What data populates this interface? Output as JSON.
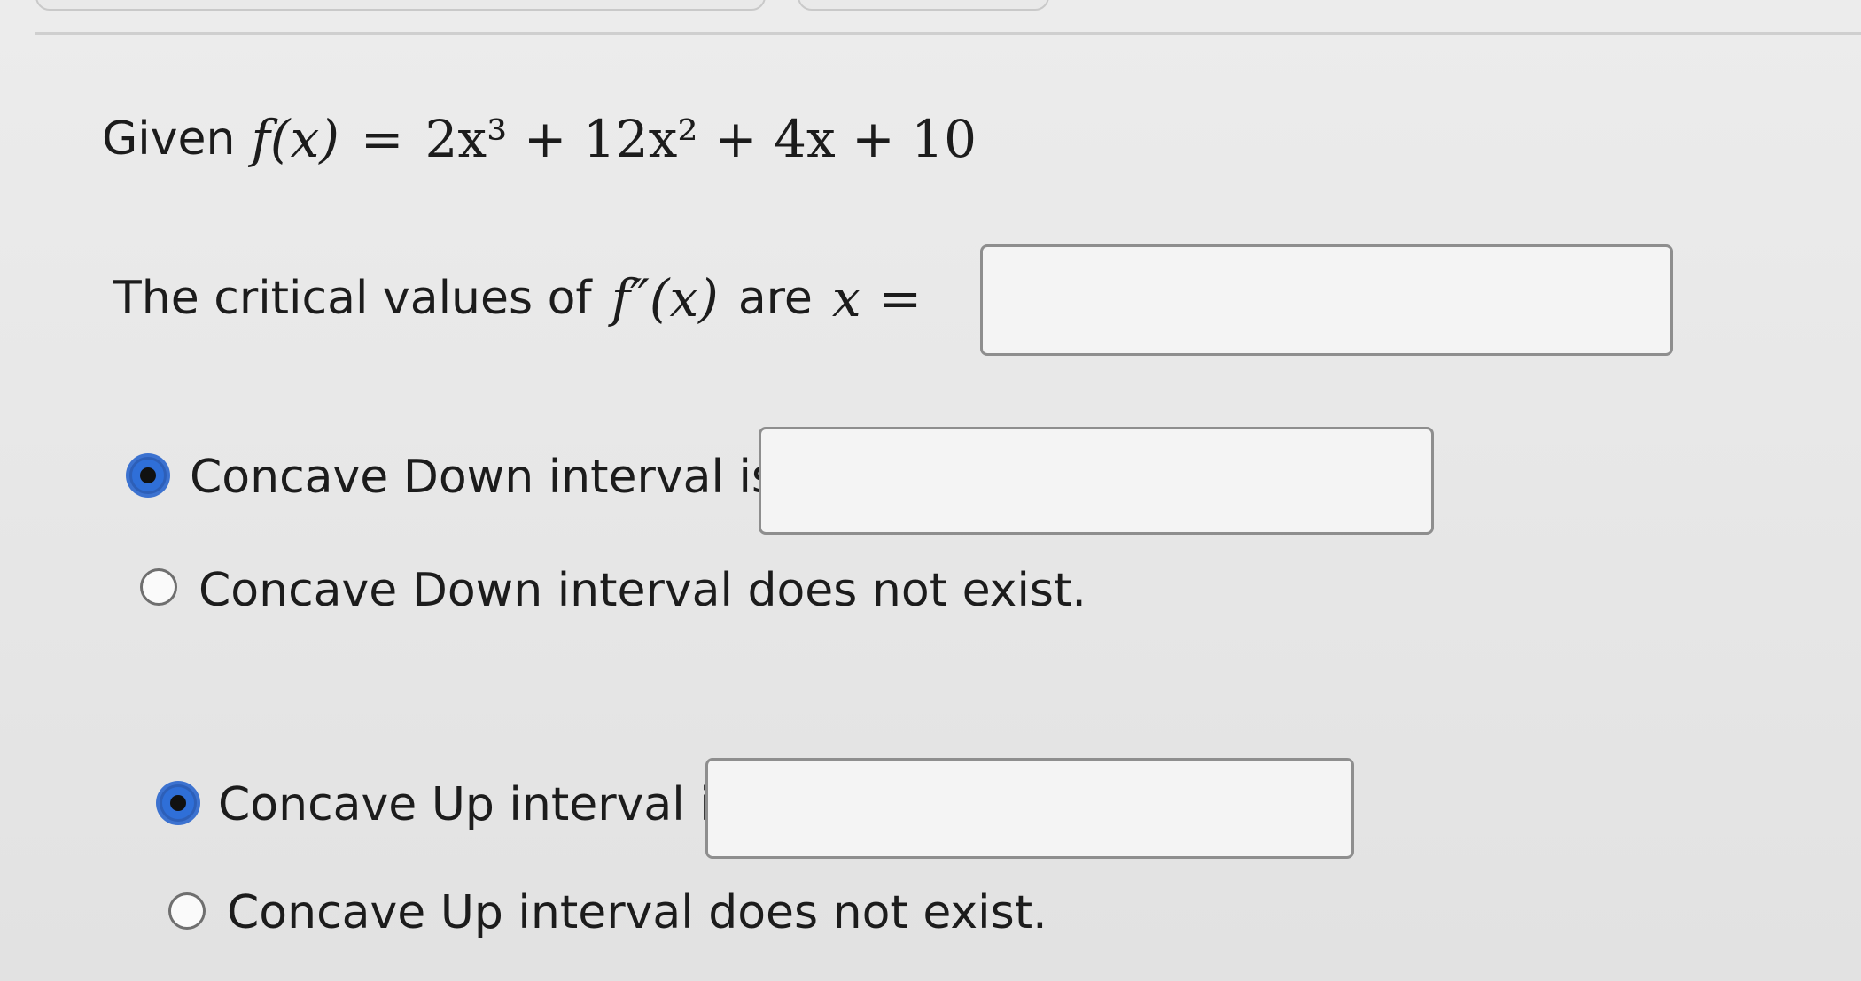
{
  "problem": {
    "given_label": "Given",
    "function_lhs": "f(x)",
    "equals": "=",
    "function_rhs": "2x³ + 12x² + 4x + 10"
  },
  "critical": {
    "prefix": "The critical values of",
    "derivative": "f″(x)",
    "middle": "are",
    "variable": "x",
    "equals": "=",
    "answer_value": ""
  },
  "concave_down": {
    "option_interval_label": "Concave Down interval is",
    "option_interval_selected": true,
    "interval_value": "",
    "option_none_label": "Concave Down interval does not exist.",
    "option_none_selected": false
  },
  "concave_up": {
    "option_interval_label": "Concave Up interval is",
    "option_interval_selected": true,
    "interval_value": "",
    "option_none_label": "Concave Up interval does not exist.",
    "option_none_selected": false
  },
  "colors": {
    "background": "#e8e8e8",
    "text": "#1c1c1c",
    "radio_selected": "#2f6fd8",
    "box_border": "#8e8e8e"
  }
}
